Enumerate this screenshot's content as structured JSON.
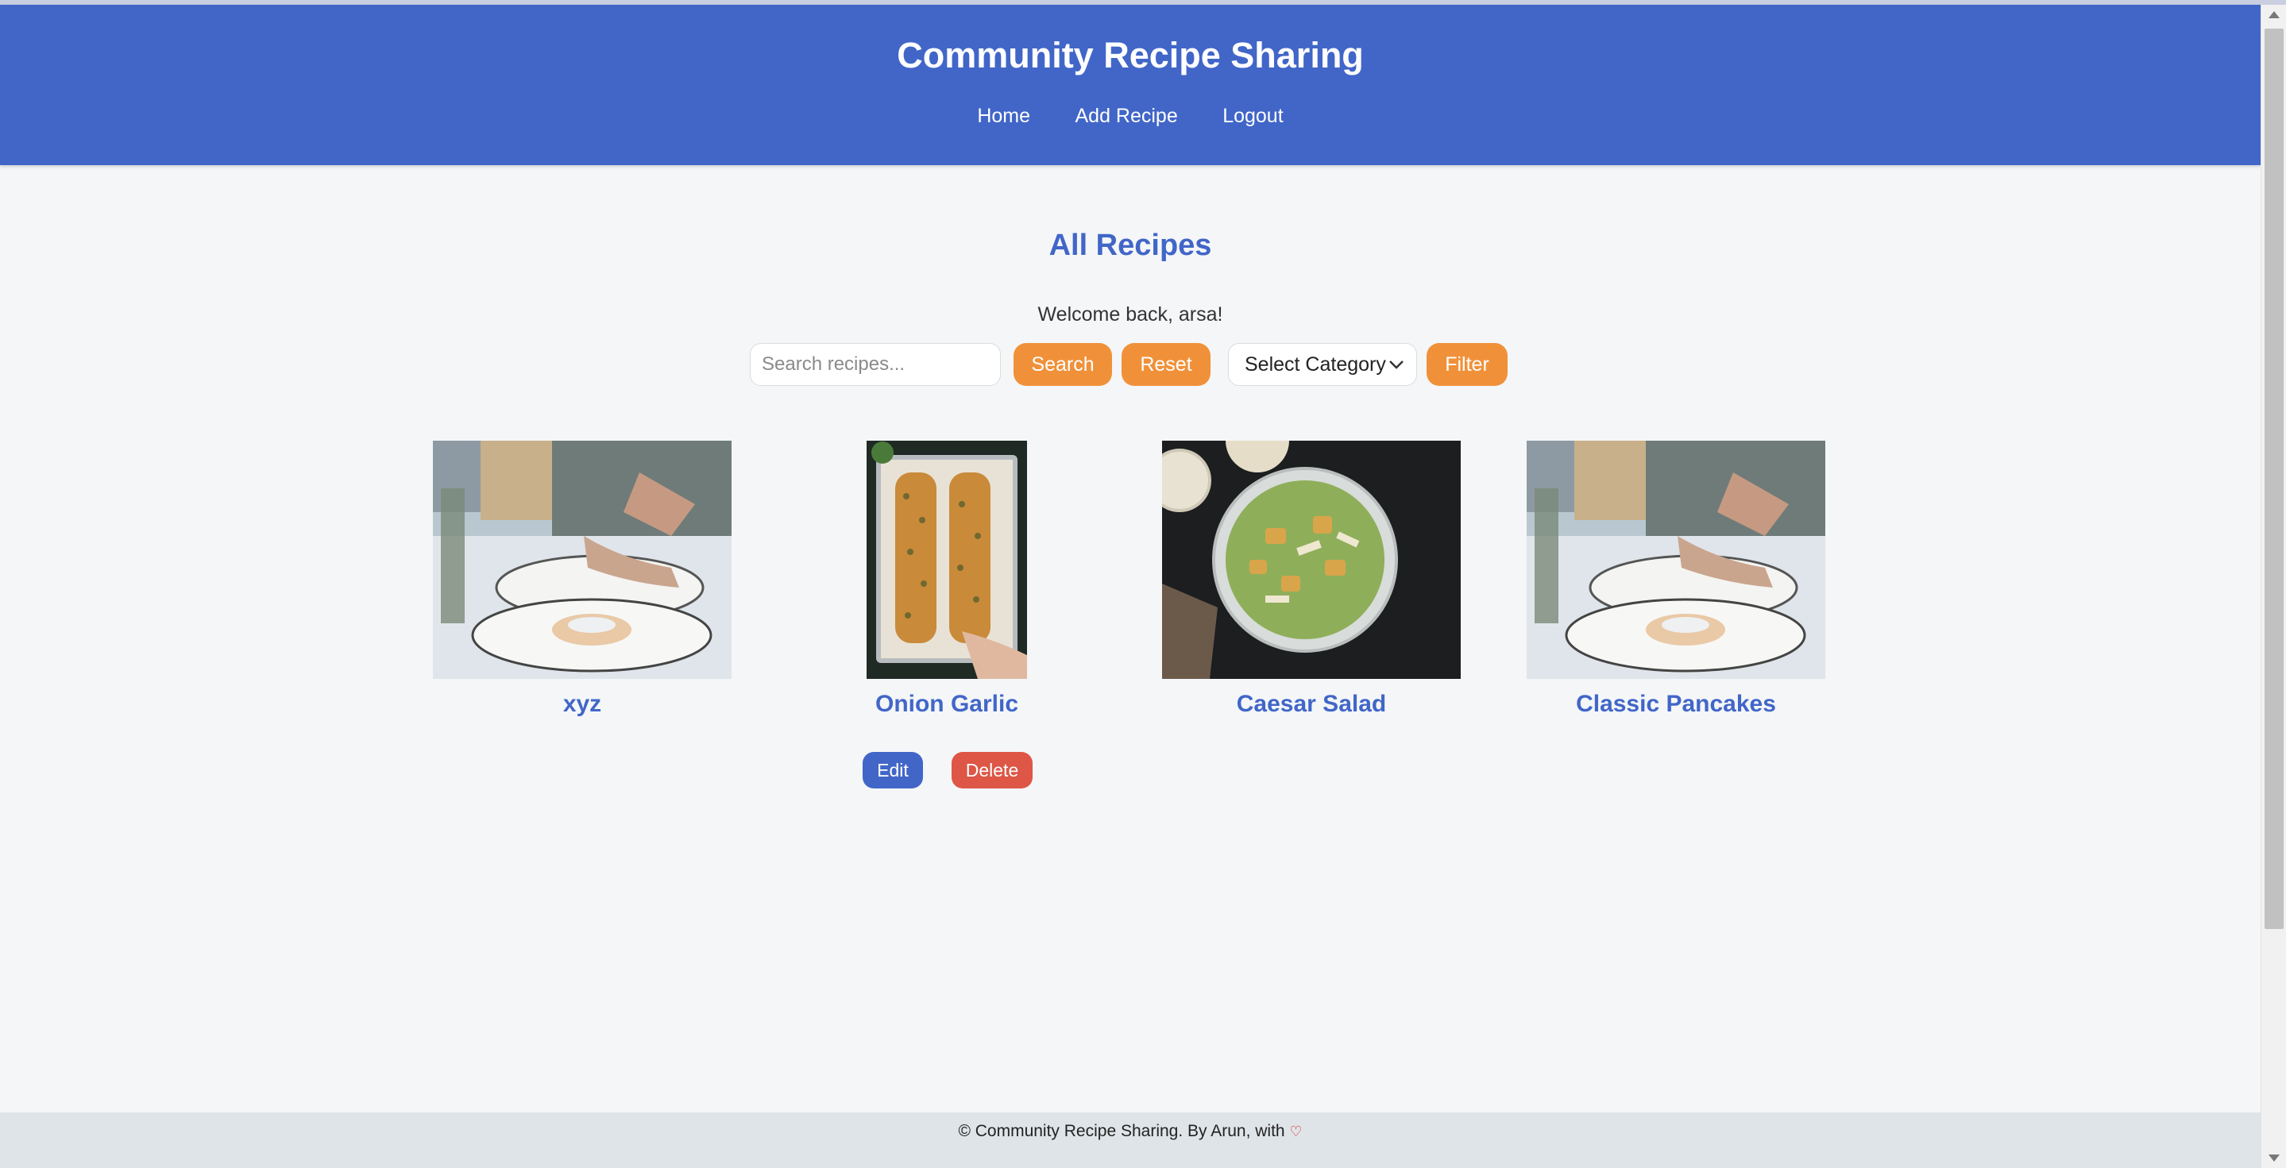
{
  "header": {
    "title": "Community Recipe Sharing",
    "nav": [
      "Home",
      "Add Recipe",
      "Logout"
    ]
  },
  "main": {
    "heading": "All Recipes",
    "welcome": "Welcome back, arsa!",
    "search": {
      "placeholder": "Search recipes...",
      "value": "",
      "search_label": "Search",
      "reset_label": "Reset"
    },
    "category": {
      "selected": "Select Category",
      "filter_label": "Filter"
    },
    "recipes": [
      {
        "title": "xyz",
        "image": "pancake-plate-photo"
      },
      {
        "title": "Onion Garlic",
        "image": "garlic-bread-tray-photo"
      },
      {
        "title": "Caesar Salad",
        "image": "caesar-salad-bowl-photo"
      },
      {
        "title": "Classic Pancakes",
        "image": "pancake-plate-photo"
      }
    ],
    "actions": {
      "edit_label": "Edit",
      "delete_label": "Delete"
    }
  },
  "footer": {
    "text": "© Community Recipe Sharing. By Arun, with",
    "icon": "heart-icon"
  },
  "colors": {
    "primary": "#4166c8",
    "accent": "#f0913a",
    "danger": "#dd5646",
    "background": "#f4f6f8"
  }
}
